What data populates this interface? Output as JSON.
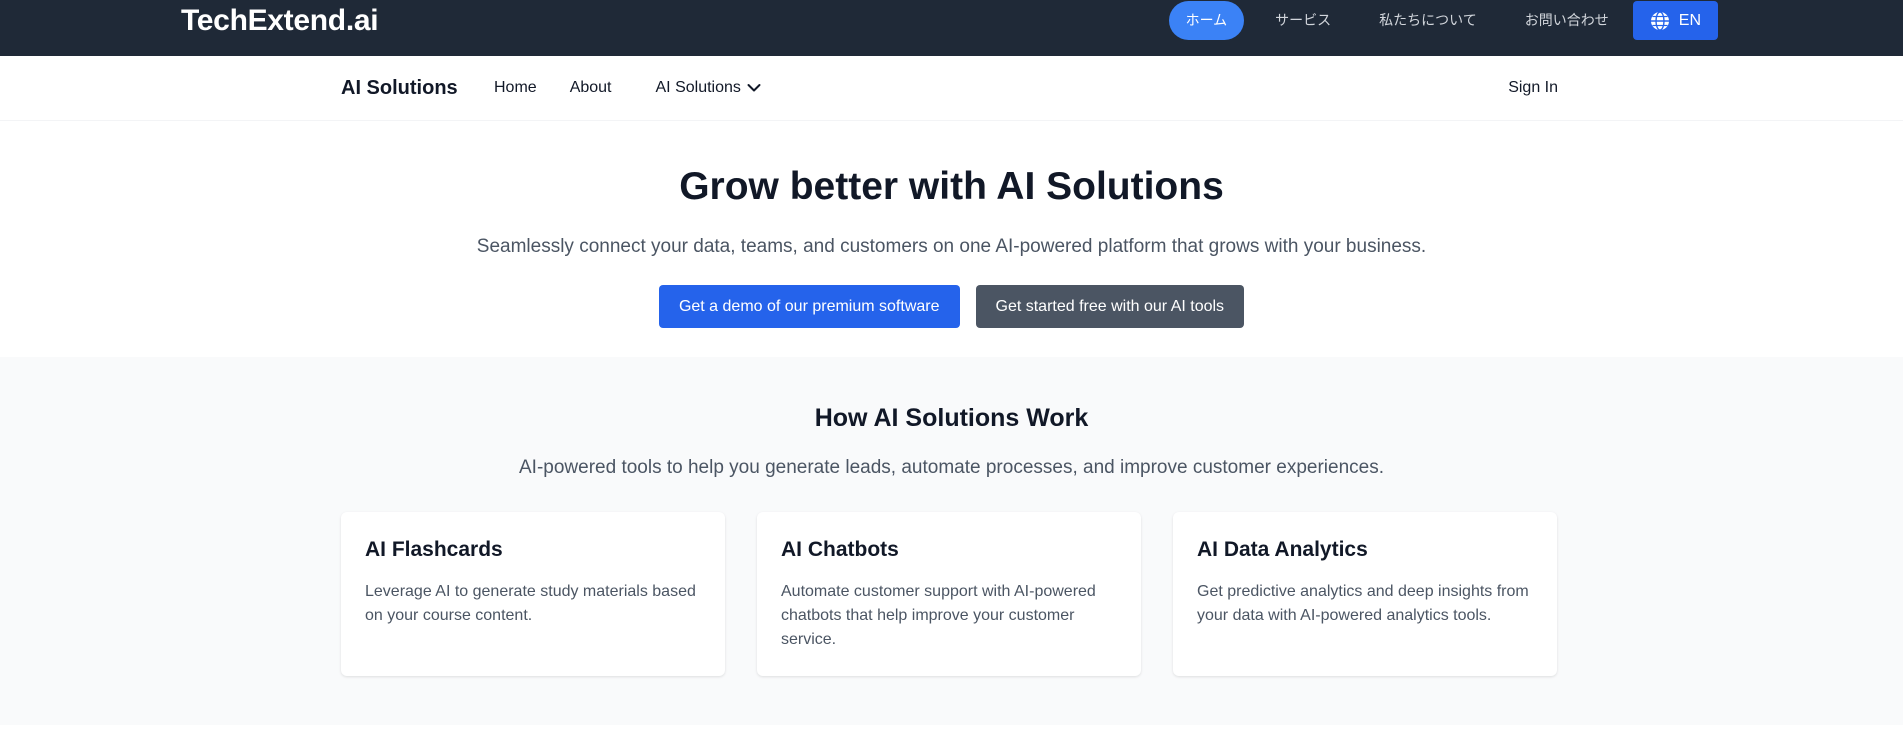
{
  "topbar": {
    "brand": "TechExtend.ai",
    "nav": [
      "ホーム",
      "サービス",
      "私たちについて",
      "お問い合わせ"
    ],
    "lang_label": "EN",
    "active_color": "#3b82f6"
  },
  "subnav": {
    "title": "AI Solutions",
    "links": [
      "Home",
      "About"
    ],
    "dropdown_label": "AI Solutions",
    "signin": "Sign In"
  },
  "hero": {
    "title": "Grow better with AI Solutions",
    "subtitle": "Seamlessly connect your data, teams, and customers on one AI-powered platform that grows with your business.",
    "primary_btn": "Get a demo of our premium software",
    "secondary_btn": "Get started free with our AI tools"
  },
  "how": {
    "title": "How AI Solutions Work",
    "subtitle": "AI-powered tools to help you generate leads, automate processes, and improve customer experiences.",
    "cards": [
      {
        "title": "AI Flashcards",
        "text": "Leverage AI to generate study materials based on your course content."
      },
      {
        "title": "AI Chatbots",
        "text": "Automate customer support with AI-powered chatbots that help improve your customer service."
      },
      {
        "title": "AI Data Analytics",
        "text": "Get predictive analytics and deep insights from your data with AI-powered analytics tools."
      }
    ]
  },
  "icons": {
    "language": "globe-icon",
    "dropdown": "chevron-down-icon"
  }
}
